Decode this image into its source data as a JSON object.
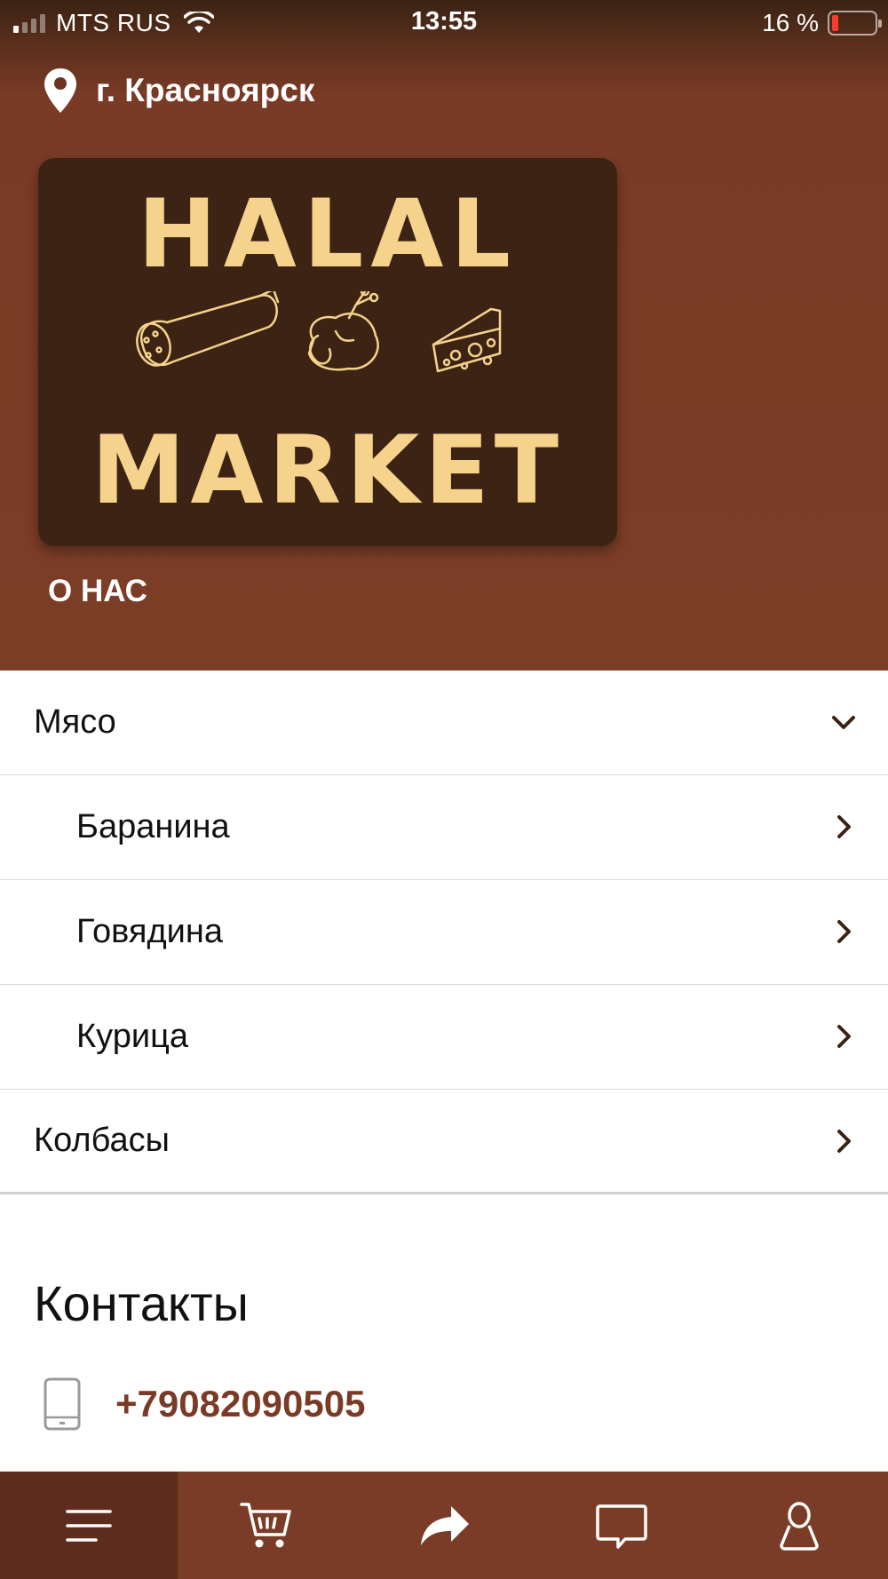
{
  "status_bar": {
    "carrier": "MTS RUS",
    "time": "13:55",
    "battery": "16 %",
    "battery_level": 0.16
  },
  "header": {
    "city": "г. Красноярск",
    "logo": {
      "line1": "HALAL",
      "line2": "MARKET"
    },
    "about_label": "О НАС"
  },
  "menu": {
    "items": [
      {
        "label": "Мясо",
        "level": "top",
        "state": "expanded"
      },
      {
        "label": "Баранина",
        "level": "sub",
        "state": "collapsed"
      },
      {
        "label": "Говядина",
        "level": "sub",
        "state": "collapsed"
      },
      {
        "label": "Курица",
        "level": "sub",
        "state": "collapsed"
      },
      {
        "label": "Колбасы",
        "level": "top",
        "state": "collapsed"
      }
    ]
  },
  "contacts": {
    "title": "Контакты",
    "phone": "+79082090505"
  },
  "tabbar": {
    "tabs": [
      {
        "icon": "menu-icon",
        "active": true
      },
      {
        "icon": "cart-icon",
        "active": false
      },
      {
        "icon": "share-icon",
        "active": false
      },
      {
        "icon": "chat-icon",
        "active": false
      },
      {
        "icon": "profile-icon",
        "active": false
      }
    ]
  },
  "colors": {
    "brand": "#7b3c27",
    "brand_dark": "#3c2314",
    "logo_gold": "#f6d38c",
    "active_tab": "#5e2c1c"
  }
}
